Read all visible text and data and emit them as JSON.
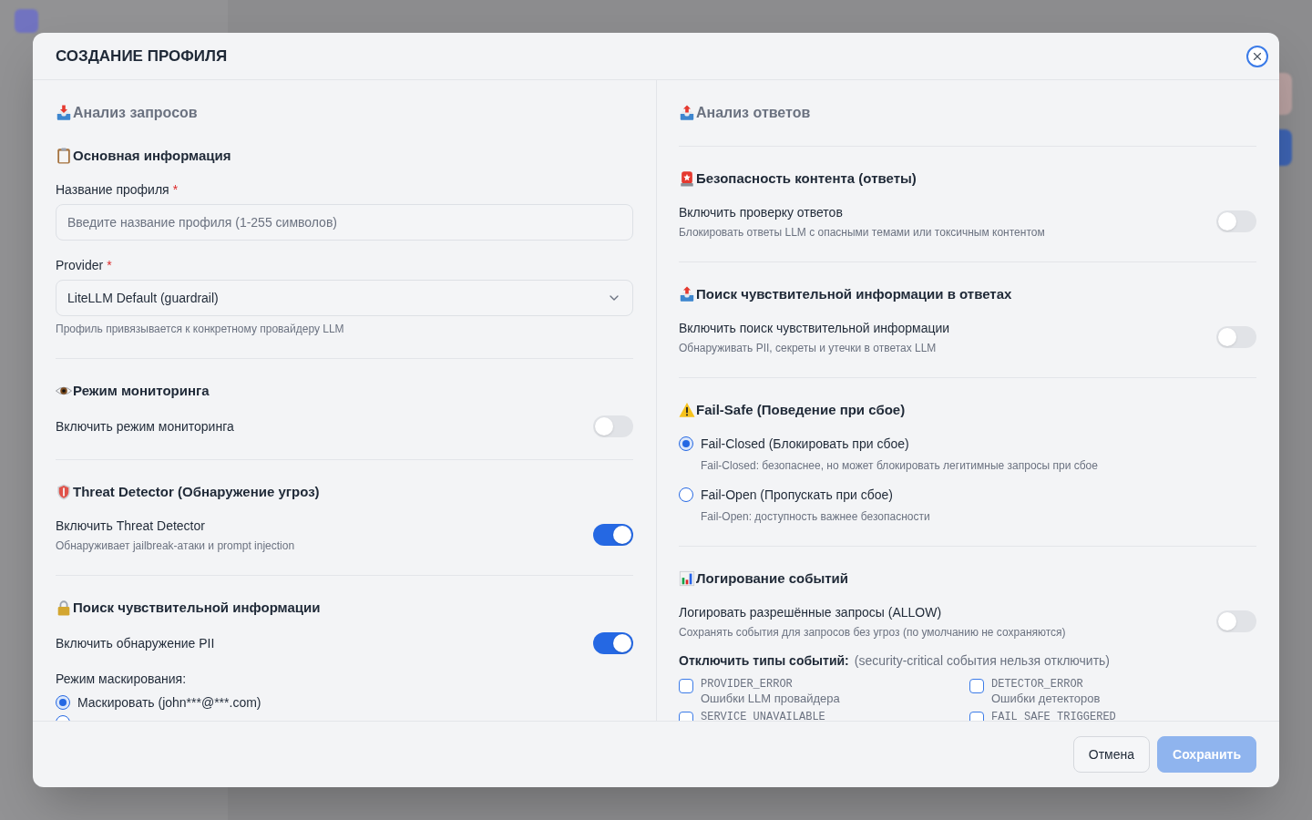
{
  "dialog": {
    "title": "СОЗДАНИЕ ПРОФИЛЯ"
  },
  "columns": [
    {
      "title": "Анализ запросов",
      "sections": [
        {
          "title": "Основная информация",
          "items": [
            {
              "kind": "text_field",
              "label": "Название профиля",
              "required_mark": "*",
              "placeholder": "Введите название профиля (1-255 символов)"
            },
            {
              "kind": "select",
              "label": "Provider",
              "required_mark": "*",
              "value": "LiteLLM Default (guardrail)",
              "hint": "Профиль привязывается к конкретному провайдеру LLM"
            }
          ]
        },
        {
          "title": "Режим мониторинга",
          "items": [
            {
              "kind": "toggle",
              "label": "Включить режим мониторинга",
              "on": false
            }
          ]
        },
        {
          "title": "Threat Detector (Обнаружение угроз)",
          "items": [
            {
              "kind": "toggle",
              "label": "Включить Threat Detector",
              "description": "Обнаруживает jailbreak-атаки и prompt injection",
              "on": true
            }
          ]
        },
        {
          "title": "Поиск чувствительной информации",
          "items": [
            {
              "kind": "toggle",
              "label": "Включить обнаружение PII",
              "on": true
            },
            {
              "kind": "radio_group",
              "label": "Режим маскирования:",
              "options": [
                {
                  "label": "Маскировать (john***@***.com)",
                  "selected": true
                },
                {
                  "selected": false
                }
              ]
            }
          ]
        }
      ]
    },
    {
      "title": "Анализ ответов",
      "sections": [
        {
          "title": "Безопасность контента (ответы)",
          "items": [
            {
              "kind": "toggle",
              "label": "Включить проверку ответов",
              "description": "Блокировать ответы LLM с опасными темами или токсичным контентом",
              "on": false
            }
          ]
        },
        {
          "title": "Поиск чувствительной информации в ответах",
          "items": [
            {
              "kind": "toggle",
              "label": "Включить поиск чувствительной информации",
              "description": "Обнаруживать PII, секреты и утечки в ответах LLM",
              "on": false
            }
          ]
        },
        {
          "title": "Fail-Safe (Поведение при сбое)",
          "items": [
            {
              "kind": "radio_group",
              "options": [
                {
                  "label": "Fail-Closed (Блокировать при сбое)",
                  "description": "Fail-Closed: безопаснее, но может блокировать легитимные запросы при сбое",
                  "selected": true
                },
                {
                  "label": "Fail-Open (Пропускать при сбое)",
                  "description": "Fail-Open: доступность важнее безопасности",
                  "selected": false
                }
              ]
            }
          ]
        },
        {
          "title": "Логирование событий",
          "items": [
            {
              "kind": "toggle",
              "label": "Логировать разрешённые запросы (ALLOW)",
              "description": "Сохранять события для запросов без угроз (по умолчанию не сохраняются)",
              "on": false
            },
            {
              "kind": "checkbox_grid",
              "label": "Отключить типы событий:",
              "note": "(security-critical события нельзя отключить)",
              "options": [
                {
                  "code": "PROVIDER_ERROR",
                  "description": "Ошибки LLM провайдера",
                  "checked": false
                },
                {
                  "code": "DETECTOR_ERROR",
                  "description": "Ошибки детекторов",
                  "checked": false
                },
                {
                  "code": "SERVICE_UNAVAILABLE",
                  "checked": false
                },
                {
                  "code": "FAIL_SAFE_TRIGGERED",
                  "checked": false
                }
              ]
            }
          ]
        }
      ]
    }
  ],
  "footer": {
    "buttons": [
      {
        "kind": "secondary",
        "label": "Отмена"
      },
      {
        "kind": "primary",
        "label": "Сохранить",
        "disabled": true
      }
    ]
  }
}
